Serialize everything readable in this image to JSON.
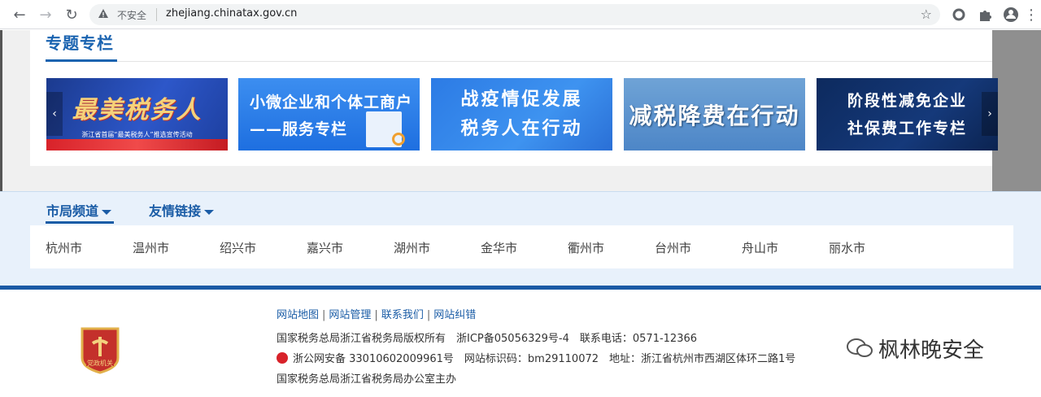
{
  "browser": {
    "security_label": "不安全",
    "url": "zhejiang.chinatax.gov.cn"
  },
  "special": {
    "title": "专题专栏",
    "banners": [
      {
        "line1": "最美税务人",
        "line2": "浙江省首届“最美税务人”推选宣传活动"
      },
      {
        "line1": "小微企业和个体工商户",
        "line2": "——服务专栏"
      },
      {
        "line1": "战疫情促发展",
        "line2": "税务人在行动"
      },
      {
        "line1": "减税降费在行动"
      },
      {
        "line1": "阶段性减免企业",
        "line2": "社保费工作专栏"
      }
    ]
  },
  "channels": {
    "tabs": [
      "市局频道",
      "友情链接"
    ],
    "cities": [
      "杭州市",
      "温州市",
      "绍兴市",
      "嘉兴市",
      "湖州市",
      "金华市",
      "衢州市",
      "台州市",
      "舟山市",
      "丽水市"
    ]
  },
  "footer": {
    "links": [
      "网站地图",
      "网站管理",
      "联系我们",
      "网站纠错"
    ],
    "line1": "国家税务总局浙江省税务局版权所有　浙ICP备05056329号-4　联系电话：0571-12366",
    "line2": "浙公网安备 33010602009961号　网站标识码：bm29110072　地址：浙江省杭州市西湖区体环二路1号",
    "line3": "国家税务总局浙江省税务局办公室主办",
    "emblem_text": "党政机关"
  },
  "watermark": "枫林晚安全"
}
